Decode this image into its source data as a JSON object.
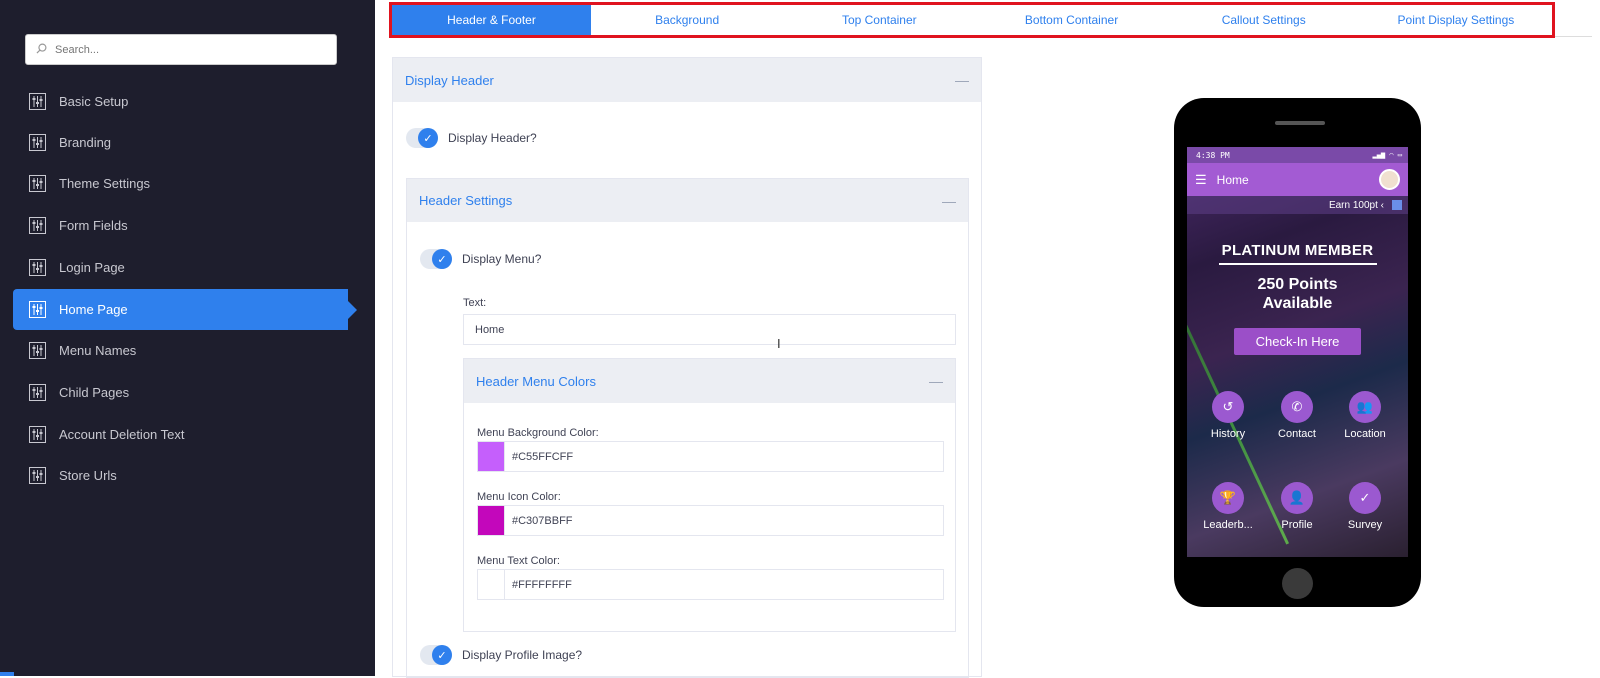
{
  "sidebar": {
    "search_placeholder": "Search...",
    "items": [
      {
        "label": "Basic Setup"
      },
      {
        "label": "Branding"
      },
      {
        "label": "Theme Settings"
      },
      {
        "label": "Form Fields"
      },
      {
        "label": "Login Page"
      },
      {
        "label": "Home Page",
        "active": true
      },
      {
        "label": "Menu Names"
      },
      {
        "label": "Child Pages"
      },
      {
        "label": "Account Deletion Text"
      },
      {
        "label": "Store Urls"
      }
    ]
  },
  "tabs": [
    {
      "label": "Header & Footer",
      "active": true
    },
    {
      "label": "Background"
    },
    {
      "label": "Top Container"
    },
    {
      "label": "Bottom Container"
    },
    {
      "label": "Callout Settings"
    },
    {
      "label": "Point Display Settings"
    }
  ],
  "form": {
    "display_header_title": "Display Header",
    "display_header_toggle": "Display Header?",
    "header_settings_title": "Header Settings",
    "display_menu_toggle": "Display Menu?",
    "text_label": "Text:",
    "text_value": "Home",
    "menu_colors_title": "Header Menu Colors",
    "menu_bg_label": "Menu Background Color:",
    "menu_bg_value": "#C55FFCFF",
    "menu_bg_color": "#c55ffc",
    "menu_icon_label": "Menu Icon Color:",
    "menu_icon_value": "#C307BBFF",
    "menu_icon_color": "#c307bb",
    "menu_text_label": "Menu Text Color:",
    "menu_text_value": "#FFFFFFFF",
    "menu_text_color": "#ffffff",
    "display_profile_toggle": "Display Profile Image?"
  },
  "phone": {
    "time": "4:38 PM",
    "app_title": "Home",
    "earn_text": "Earn 100pt ‹",
    "member": "PLATINUM MEMBER",
    "points_line1": "250 Points",
    "points_line2": "Available",
    "checkin": "Check-In Here",
    "grid": [
      {
        "label": "History",
        "icon": "history-icon"
      },
      {
        "label": "Contact",
        "icon": "phone-icon"
      },
      {
        "label": "Location",
        "icon": "people-icon"
      },
      {
        "label": "Leaderb...",
        "icon": "trophy-icon"
      },
      {
        "label": "Profile",
        "icon": "profile-icon"
      },
      {
        "label": "Survey",
        "icon": "check-icon"
      }
    ]
  },
  "colors": {
    "accent": "#2f80ed",
    "sidebar_bg": "#1e1e2d",
    "highlight": "#e0131f"
  }
}
